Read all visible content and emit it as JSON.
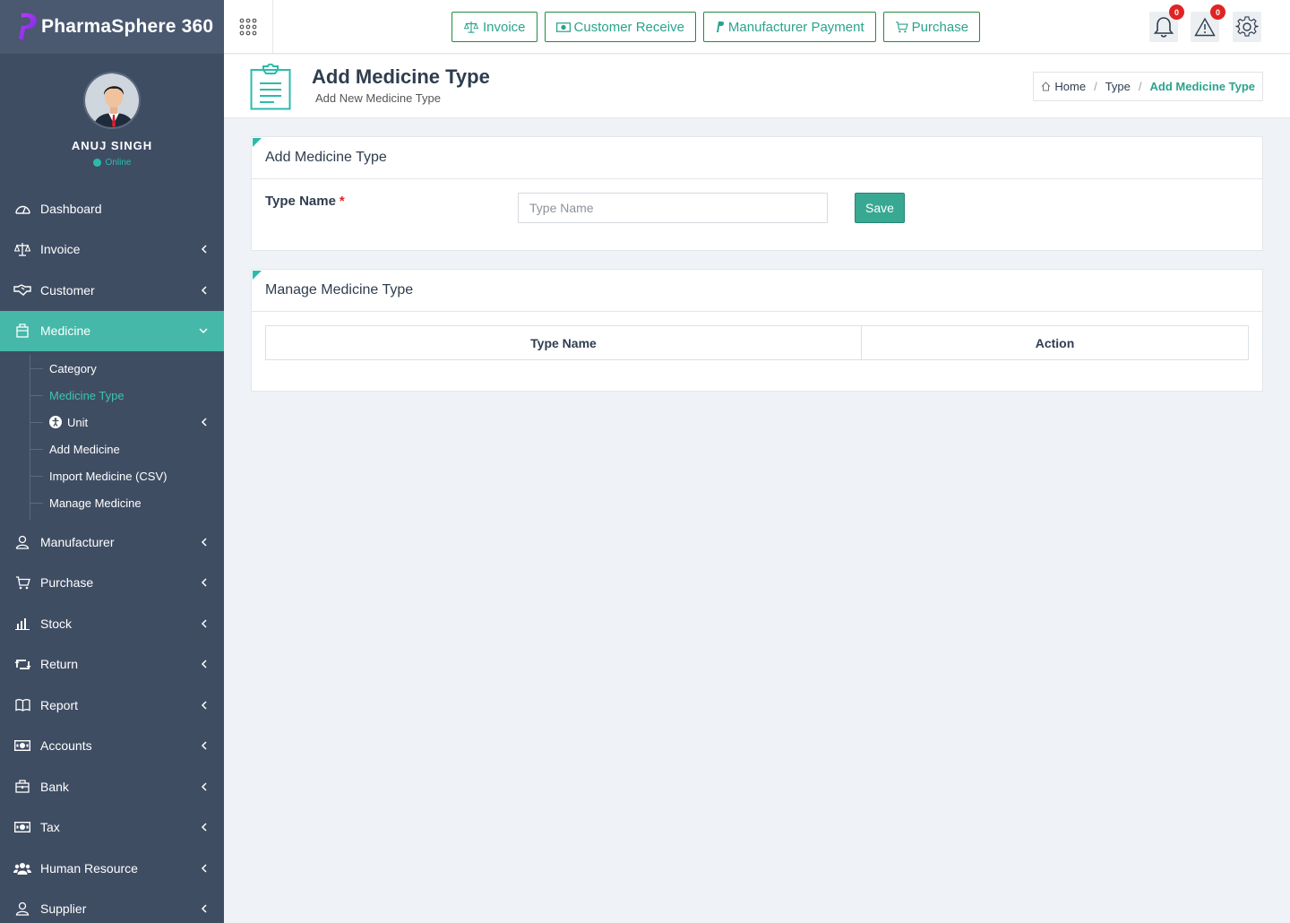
{
  "brand": {
    "name": "PharmaSphere 360"
  },
  "user": {
    "name": "ANUJ SINGH",
    "status": "Online"
  },
  "sidebar": {
    "items": [
      {
        "label": "Dashboard",
        "icon": "dashboard-icon"
      },
      {
        "label": "Invoice",
        "icon": "balance-icon"
      },
      {
        "label": "Customer",
        "icon": "handshake-icon"
      },
      {
        "label": "Medicine",
        "icon": "box-icon"
      },
      {
        "label": "Manufacturer",
        "icon": "user-icon"
      },
      {
        "label": "Purchase",
        "icon": "cart-icon"
      },
      {
        "label": "Stock",
        "icon": "bar-chart-icon"
      },
      {
        "label": "Return",
        "icon": "retweet-icon"
      },
      {
        "label": "Report",
        "icon": "book-icon"
      },
      {
        "label": "Accounts",
        "icon": "money-icon"
      },
      {
        "label": "Bank",
        "icon": "bank-icon"
      },
      {
        "label": "Tax",
        "icon": "money-icon"
      },
      {
        "label": "Human Resource",
        "icon": "users-icon"
      },
      {
        "label": "Supplier",
        "icon": "user-icon"
      }
    ],
    "medicine_sub": [
      {
        "label": "Category"
      },
      {
        "label": "Medicine Type"
      },
      {
        "label": "Unit"
      },
      {
        "label": "Add Medicine"
      },
      {
        "label": "Import Medicine (CSV)"
      },
      {
        "label": "Manage Medicine"
      }
    ]
  },
  "topbar": {
    "quick": [
      "Invoice",
      "Customer Receive",
      "Manufacturer Payment",
      "Purchase"
    ],
    "notifications_count": "0",
    "alerts_count": "0"
  },
  "page": {
    "title": "Add Medicine Type",
    "subtitle": "Add New Medicine Type",
    "breadcrumb": [
      "Home",
      "Type",
      "Add Medicine Type"
    ]
  },
  "form": {
    "panel_title": "Add Medicine Type",
    "label": "Type Name",
    "required_mark": "*",
    "placeholder": "Type Name",
    "save_label": "Save"
  },
  "manage": {
    "panel_title": "Manage Medicine Type",
    "columns": [
      "Type Name",
      "Action"
    ]
  },
  "colors": {
    "accent": "#45b8a9",
    "sidebar": "#3f4d63",
    "danger": "#e02424"
  }
}
